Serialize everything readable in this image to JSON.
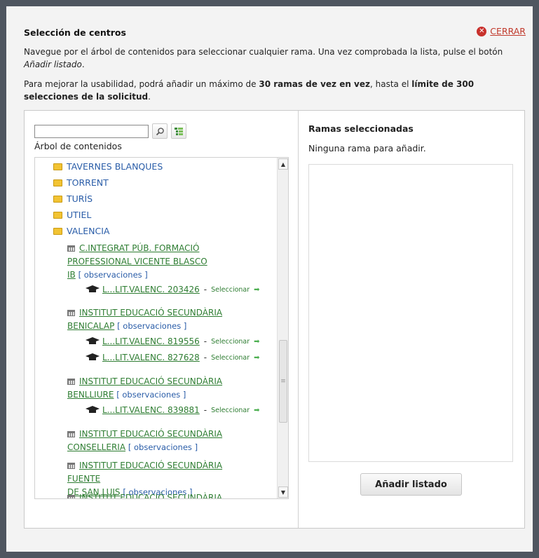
{
  "dialog": {
    "title": "Selección de centros",
    "close_label": "CERRAR",
    "intro_text": "Navegue por el árbol de contenidos para seleccionar cualquier rama. Una vez comprobada la lista, pulse el botón ",
    "intro_em": "Añadir listado",
    "intro_end": ".",
    "limit_text_1": "Para mejorar la usabilidad, podrá añadir un máximo de ",
    "limit_bold_1": "30 ramas de vez en vez",
    "limit_text_2": ", hasta el ",
    "limit_bold_2": "límite de 300 selecciones de la solicitud",
    "limit_text_3": "."
  },
  "tree": {
    "search_value": "",
    "label": "Árbol de contenidos",
    "folders": [
      "TAVERNES BLANQUES",
      "TORRENT",
      "TURÍS",
      "UTIEL",
      "VALENCIA"
    ],
    "centers": [
      {
        "line1": "C.INTEGRAT PÚB. FORMACIÓ",
        "line2": "PROFESSIONAL VICENTE BLASCO",
        "line3": "IB",
        "obs": "[ observaciones ]",
        "courses": [
          {
            "name": "L...LIT.VALENC. 203426",
            "select": "Seleccionar"
          }
        ]
      },
      {
        "line1": "INSTITUT EDUCACIÓ SECUNDÀRIA",
        "line2": "BENICALAP",
        "obs": "[ observaciones ]",
        "courses": [
          {
            "name": "L...LIT.VALENC. 819556",
            "select": "Seleccionar"
          },
          {
            "name": "L...LIT.VALENC. 827628",
            "select": "Seleccionar"
          }
        ]
      },
      {
        "line1": "INSTITUT EDUCACIÓ SECUNDÀRIA",
        "line2": "BENLLIURE",
        "obs": "[ observaciones ]",
        "courses": [
          {
            "name": "L...LIT.VALENC. 839881",
            "select": "Seleccionar"
          }
        ]
      },
      {
        "line1": "INSTITUT EDUCACIÓ SECUNDÀRIA",
        "line2": "CONSELLERIA",
        "obs": "[ observaciones ]",
        "courses": []
      },
      {
        "line1": "INSTITUT EDUCACIÓ SECUNDÀRIA FUENTE",
        "line2": "DE SAN LUIS",
        "obs": "[ observaciones ]",
        "courses": []
      },
      {
        "line1": "INSTITUT EDUCACIÓ SECUNDÀRIA JOANOT",
        "courses": []
      }
    ]
  },
  "selected": {
    "title": "Ramas seleccionadas",
    "empty_text": "Ninguna rama para añadir.",
    "add_button": "Añadir listado"
  },
  "icons": {
    "close": "close-circle-icon",
    "search": "magnifier-icon",
    "tree_toggle": "tree-expand-icon",
    "folder": "folder-icon",
    "center": "building-icon",
    "course": "graduation-cap-icon",
    "select_arrow": "arrow-right-icon"
  },
  "colors": {
    "link_green": "#2e7d32",
    "folder_blue": "#2a5da8",
    "close_red": "#c0392b",
    "backdrop": "#4f5660"
  }
}
